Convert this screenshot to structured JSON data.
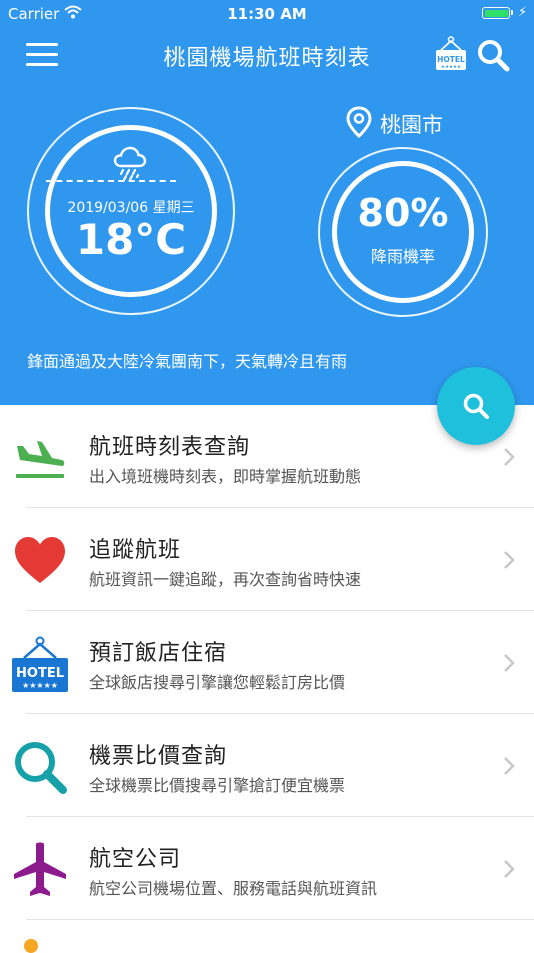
{
  "status_bar": {
    "carrier": "Carrier",
    "time": "11:30 AM"
  },
  "header": {
    "title": "桃園機場航班時刻表",
    "menu_icon": "hamburger-menu-icon",
    "hotel_icon": "hotel-sign-icon",
    "hotel_sign_text": "HOTEL",
    "search_icon": "search-icon"
  },
  "weather": {
    "icon": "cloud-rain-icon",
    "date": "2019/03/06 星期三",
    "temperature": "18°C",
    "location": "桃園市",
    "rain_probability": "80%",
    "rain_label": "降雨機率",
    "forecast": "鋒面通過及大陸冷氣團南下，天氣轉冷且有雨"
  },
  "colors": {
    "header_bg": "#2f97ee",
    "fab": "#1fc0dc",
    "flight_icon": "#4caf50",
    "heart": "#e53935",
    "hotel": "#1976d2",
    "search_teal": "#16a0a8",
    "airline": "#8e1b8e"
  },
  "menu": [
    {
      "title": "航班時刻表查詢",
      "description": "出入境班機時刻表，即時掌握航班動態",
      "icon": "airplane-landing-icon"
    },
    {
      "title": "追蹤航班",
      "description": "航班資訊一鍵追蹤，再次查詢省時快速",
      "icon": "heart-icon"
    },
    {
      "title": "預訂飯店住宿",
      "description": "全球飯店搜尋引擎讓您輕鬆訂房比價",
      "icon": "hotel-icon",
      "icon_text": "HOTEL"
    },
    {
      "title": "機票比價查詢",
      "description": "全球機票比價搜尋引擎搶訂便宜機票",
      "icon": "magnifier-icon"
    },
    {
      "title": "航空公司",
      "description": "航空公司機場位置、服務電話與航班資訊",
      "icon": "airplane-icon"
    }
  ]
}
